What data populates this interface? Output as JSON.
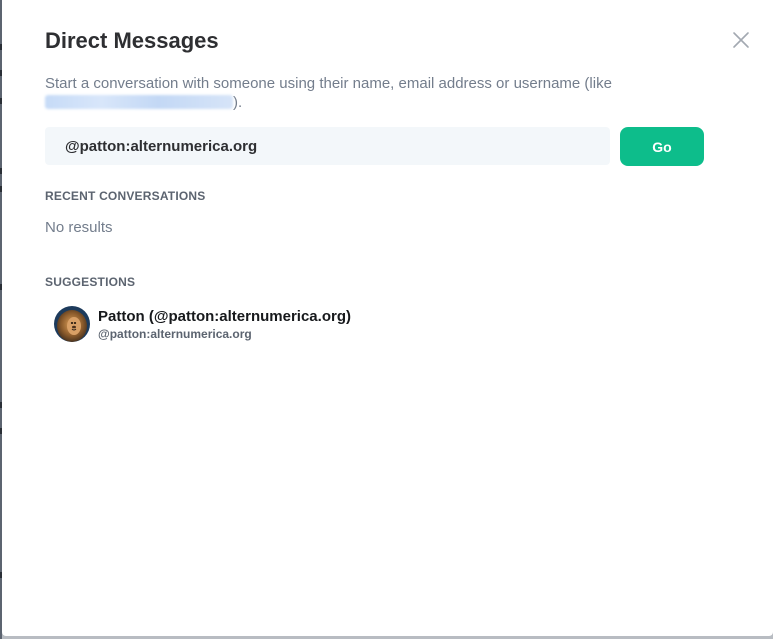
{
  "dialog": {
    "title": "Direct Messages",
    "close_icon": "close-icon",
    "instructions_prefix": "Start a conversation with someone using their name, email address or username (like ",
    "instructions_suffix": ").",
    "search": {
      "value": "@patton:alternumerica.org"
    },
    "go_label": "Go",
    "recent_heading": "RECENT CONVERSATIONS",
    "no_results": "No results",
    "suggestions_heading": "SUGGESTIONS",
    "suggestions": [
      {
        "display_name": "Patton (@patton:alternumerica.org)",
        "user_id": "@patton:alternumerica.org",
        "avatar_icon": "lion-avatar"
      }
    ]
  },
  "colors": {
    "accent": "#0dbd8b",
    "heading_text": "#5c6470",
    "secondary_text": "#737d8c",
    "input_background": "#f3f7fa"
  }
}
